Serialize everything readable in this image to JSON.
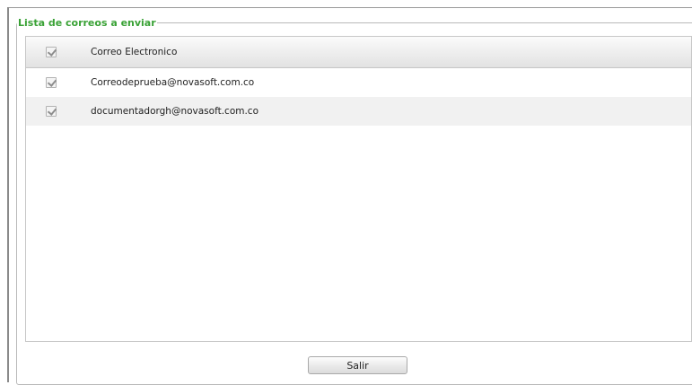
{
  "group": {
    "legend": "Lista de correos a enviar"
  },
  "grid": {
    "header": {
      "checked": true,
      "column_label": "Correo Electronico"
    },
    "rows": [
      {
        "checked": true,
        "email": "Correodeprueba@novasoft.com.co"
      },
      {
        "checked": true,
        "email": "documentadorgh@novasoft.com.co"
      }
    ]
  },
  "actions": {
    "exit_label": "Salir"
  },
  "colors": {
    "legend": "#3aa236",
    "border": "#b9b9b9",
    "alt_row": "#f1f1f1"
  }
}
